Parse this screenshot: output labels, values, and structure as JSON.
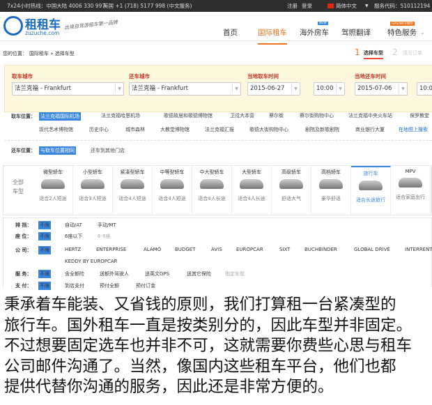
{
  "topbar": {
    "hotline": "7x24小时热线：中国大陆 4006 330 997",
    "us": "美国 +1 (718) 5177 998 (中文服务)",
    "register": "注册",
    "login": "登录",
    "language": "简体中文",
    "service_code": "服务代码：510112194"
  },
  "header": {
    "logo": "租租车",
    "logo_domain": "zuzuche.com",
    "slogan": "出境自驾游租车第一品牌",
    "nav": [
      {
        "label": "首页"
      },
      {
        "label": "国际租车"
      },
      {
        "label": "海外房车",
        "badge": "NEW"
      },
      {
        "label": "驾照翻译"
      },
      {
        "label": "特色服务",
        "badge": "GPS/WIFI/保险"
      }
    ]
  },
  "breadcrumb": {
    "prefix": "您的位置：",
    "path": "国际租车 » 选择车型"
  },
  "steps": [
    {
      "num": "1",
      "label": "选择车型"
    },
    {
      "num": "2",
      "label": "填写订单"
    }
  ],
  "form": {
    "pickup_city_label": "取车城市",
    "pickup_city": "法兰克福 - Frankfurt",
    "return_city_label": "还车城市",
    "return_city": "法兰克福 - Frankfurt",
    "pickup_time_label": "当地取车时间",
    "pickup_date": "2015-06-27",
    "pickup_time": "10:00",
    "return_time_label": "当地还车时间",
    "return_date": "2015-07-06",
    "return_time": "10:00"
  },
  "pickup": {
    "label": "取车位置：",
    "row1": [
      "法兰克福国际机场",
      "法兰克福哈恩机场",
      "歌德故居和歌德博物馆",
      "卫戍大本营",
      "蔡尔街",
      "蔡尔街购物中心",
      "法兰克福中央火车站",
      "保罗教堂"
    ],
    "row2": [
      "现代艺术博物馆",
      "历史中心",
      "城市森林",
      "大教堂博物馆",
      "法兰克福汇报",
      "歌德大街购物中心",
      "剧院及新歌剧院",
      "商业银行大厦"
    ],
    "map_link": "在地图上搜索"
  },
  "return_loc": {
    "label": "还车位置：",
    "options": [
      "与取车位置相同",
      "还车到其他门店"
    ]
  },
  "car_types": {
    "all": "全部车型",
    "items": [
      {
        "name": "微型轿车",
        "desc": "适合2人短途"
      },
      {
        "name": "小型轿车",
        "desc": "适合3人短途"
      },
      {
        "name": "紧凑型轿车",
        "desc": "适合4人短途"
      },
      {
        "name": "中等型轿车",
        "desc": "适合4人短途"
      },
      {
        "name": "中大型轿车",
        "desc": "适合4人长途"
      },
      {
        "name": "大型轿车",
        "desc": "适合4人长途"
      },
      {
        "name": "高级轿车",
        "desc": "舒适大气"
      },
      {
        "name": "高档轿车",
        "desc": "豪华舒适"
      },
      {
        "name": "旅行车",
        "desc": "适合长途旅行"
      },
      {
        "name": "MPV",
        "desc": "适合家庭出行"
      }
    ]
  },
  "filters": {
    "any": "不限",
    "transmission": {
      "label": "排 挡：",
      "options": [
        "自动/AT",
        "手动/MT"
      ]
    },
    "seats": {
      "label": "座 位：",
      "options": [
        "6座以下",
        "6-8座"
      ]
    },
    "company": {
      "label": "公 司：",
      "options": [
        "HERTZ",
        "ENTERPRISE",
        "ALAMO",
        "BUDGET",
        "AVIS",
        "EUROPCAR",
        "SIXT",
        "BUCHBINDER",
        "GLOBAL DRIVE",
        "INTERRENT",
        "KEDDY BY EUROPCAR"
      ]
    },
    "service": {
      "label": "服 务：",
      "options": [
        "含全额险",
        "送额外驾驶人",
        "送英文GPS",
        "送其它保险",
        "指定车型"
      ]
    },
    "payment": {
      "label": "支 付：",
      "options": [
        "到店支付",
        "预付全额",
        "预付订金"
      ]
    }
  },
  "article": {
    "lines": [
      "秉承着车能装、又省钱的原则，我们打算租一台紧凑型的",
      "旅行车。国外租车一直是按类别分的，因此车型并非固定。",
      "不过想要固定选车也并非不可，这就需要你费些心思与租车",
      "公司邮件沟通了。当然，像国内这些租车平台，他们也都",
      "提供代替你沟通的服务，因此还是非常方便的。"
    ]
  },
  "colors": {
    "accent": "#f07019",
    "selected": "#3a87e0",
    "form_bg": "#fdf8dd",
    "topbar": "#2e2e2e"
  }
}
